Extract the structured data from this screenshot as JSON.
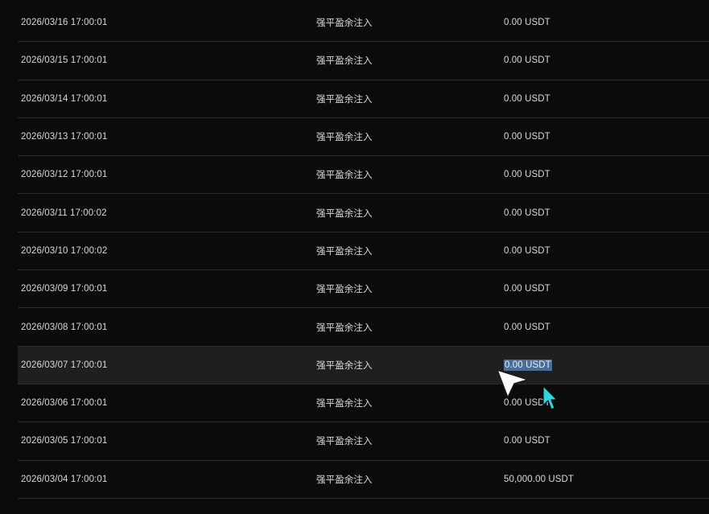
{
  "records": [
    {
      "time": "2026/03/16 17:00:01",
      "type": "强平盈余注入",
      "amount": "0.00 USDT"
    },
    {
      "time": "2026/03/15 17:00:01",
      "type": "强平盈余注入",
      "amount": "0.00 USDT"
    },
    {
      "time": "2026/03/14 17:00:01",
      "type": "强平盈余注入",
      "amount": "0.00 USDT"
    },
    {
      "time": "2026/03/13 17:00:01",
      "type": "强平盈余注入",
      "amount": "0.00 USDT"
    },
    {
      "time": "2026/03/12 17:00:01",
      "type": "强平盈余注入",
      "amount": "0.00 USDT"
    },
    {
      "time": "2026/03/11 17:00:02",
      "type": "强平盈余注入",
      "amount": "0.00 USDT"
    },
    {
      "time": "2026/03/10 17:00:02",
      "type": "强平盈余注入",
      "amount": "0.00 USDT"
    },
    {
      "time": "2026/03/09 17:00:01",
      "type": "强平盈余注入",
      "amount": "0.00 USDT"
    },
    {
      "time": "2026/03/08 17:00:01",
      "type": "强平盈余注入",
      "amount": "0.00 USDT"
    },
    {
      "time": "2026/03/07 17:00:01",
      "type": "强平盈余注入",
      "amount": "0.00 USDT"
    },
    {
      "time": "2026/03/06 17:00:01",
      "type": "强平盈余注入",
      "amount": "0.00 USDT"
    },
    {
      "time": "2026/03/05 17:00:01",
      "type": "强平盈余注入",
      "amount": "0.00 USDT"
    },
    {
      "time": "2026/03/04 17:00:01",
      "type": "强平盈余注入",
      "amount": "50,000.00 USDT"
    }
  ],
  "icons": {
    "white_cursor": "arrow-cursor-icon",
    "cyan_cursor": "arrow-cursor-icon"
  },
  "colors": {
    "background": "#0b0b0b",
    "highlight_row": "#1f1f1f",
    "selection": "#4a6e9c",
    "cursor_cyan": "#2fd6e0"
  }
}
